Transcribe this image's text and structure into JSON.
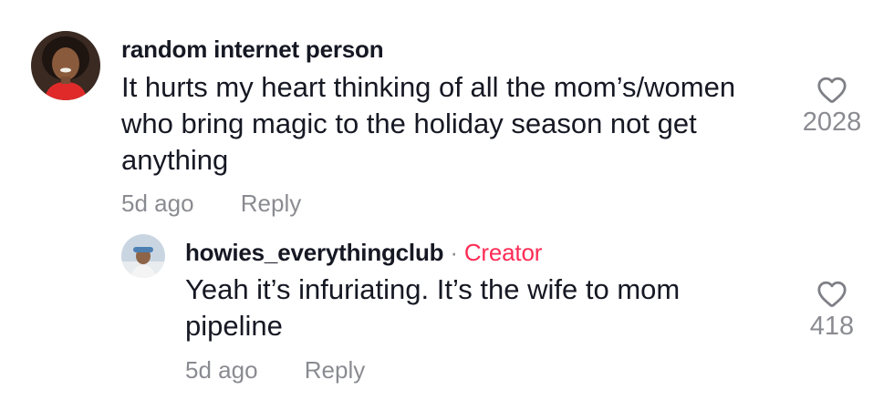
{
  "comments": [
    {
      "author": "random internet person",
      "text_lines": [
        "It hurts my heart thinking of all the mom’s/women",
        "who bring magic to the holiday season not get",
        "anything"
      ],
      "time": "5d ago",
      "reply_label": "Reply",
      "likes": "2028",
      "like_icon": "heart-outline-icon"
    },
    {
      "author": "howies_everythingclub",
      "separator": "·",
      "badge": "Creator",
      "text_lines": [
        "Yeah it’s infuriating. It’s the wife to mom",
        "pipeline"
      ],
      "time": "5d ago",
      "reply_label": "Reply",
      "likes": "418",
      "like_icon": "heart-outline-icon"
    }
  ],
  "colors": {
    "text": "#161823",
    "muted": "rgba(22,24,35,0.5)",
    "creator_badge": "#fe2c55"
  }
}
